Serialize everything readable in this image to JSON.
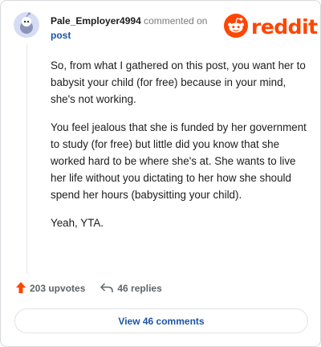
{
  "comment": {
    "username": "Pale_Employer4994",
    "action_text": "commented on",
    "post_link": "post",
    "paragraphs": [
      "So, from what I gathered on this post, you want her to babysit your child (for free) because in your mind, she's not working.",
      "You feel jealous that she is funded by her government to study (for free) but little did you know that she worked hard to be where she's at. She wants to live her life without you dictating to her how she should spend her hours (babysitting your child).",
      "Yeah, YTA."
    ]
  },
  "brand": {
    "wordmark": "reddit",
    "logo_icon": "reddit-snoo-icon",
    "color": "#ff4500"
  },
  "actions": {
    "upvotes": "203 upvotes",
    "replies": "46 replies",
    "upvote_icon": "upvote-arrow-icon",
    "reply_icon": "reply-arrow-icon"
  },
  "view_comments": "View 46 comments",
  "colors": {
    "link": "#1a55a5",
    "upvote": "#ff4500",
    "text": "#1c1c1c",
    "muted": "#7c7c7c"
  }
}
